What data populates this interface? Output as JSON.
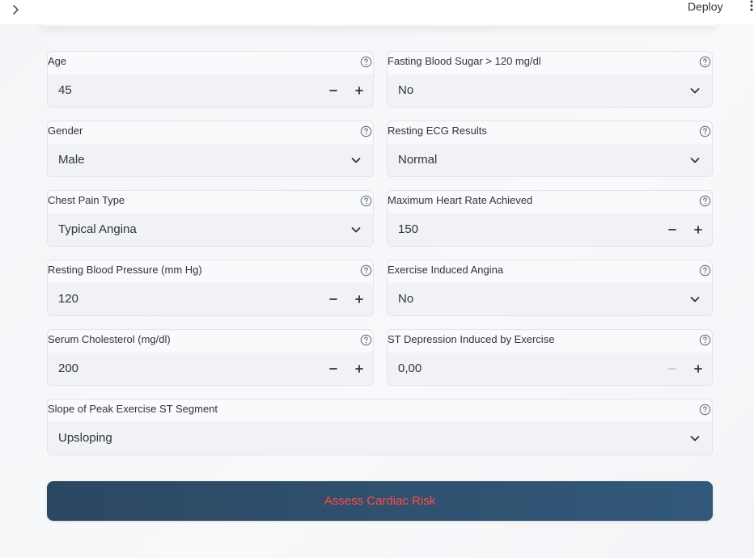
{
  "header": {
    "expand_icon": "chevron-right-icon",
    "deploy_label": "Deploy",
    "menu_icon": "kebab-menu-icon"
  },
  "form": {
    "age": {
      "label": "Age",
      "value": "45",
      "type": "number"
    },
    "fasting_blood_sugar": {
      "label": "Fasting Blood Sugar > 120 mg/dl",
      "value": "No",
      "type": "select"
    },
    "gender": {
      "label": "Gender",
      "value": "Male",
      "type": "select"
    },
    "resting_ecg": {
      "label": "Resting ECG Results",
      "value": "Normal",
      "type": "select"
    },
    "chest_pain": {
      "label": "Chest Pain Type",
      "value": "Typical Angina",
      "type": "select"
    },
    "max_heart_rate": {
      "label": "Maximum Heart Rate Achieved",
      "value": "150",
      "type": "number"
    },
    "resting_bp": {
      "label": "Resting Blood Pressure (mm Hg)",
      "value": "120",
      "type": "number"
    },
    "exercise_angina": {
      "label": "Exercise Induced Angina",
      "value": "No",
      "type": "select"
    },
    "cholesterol": {
      "label": "Serum Cholesterol (mg/dl)",
      "value": "200",
      "type": "number"
    },
    "st_depression": {
      "label": "ST Depression Induced by Exercise",
      "value": "0,00",
      "type": "number",
      "minus_disabled": true
    },
    "slope": {
      "label": "Slope of Peak Exercise ST Segment",
      "value": "Upsloping",
      "type": "select"
    }
  },
  "submit": {
    "label": "Assess Cardiac Risk"
  },
  "colors": {
    "button_start": "#2c4762",
    "button_end": "#33597a",
    "button_text": "#ff4b4b",
    "input_bg": "#f0f2f6",
    "field_border": "#e3e4e9"
  }
}
